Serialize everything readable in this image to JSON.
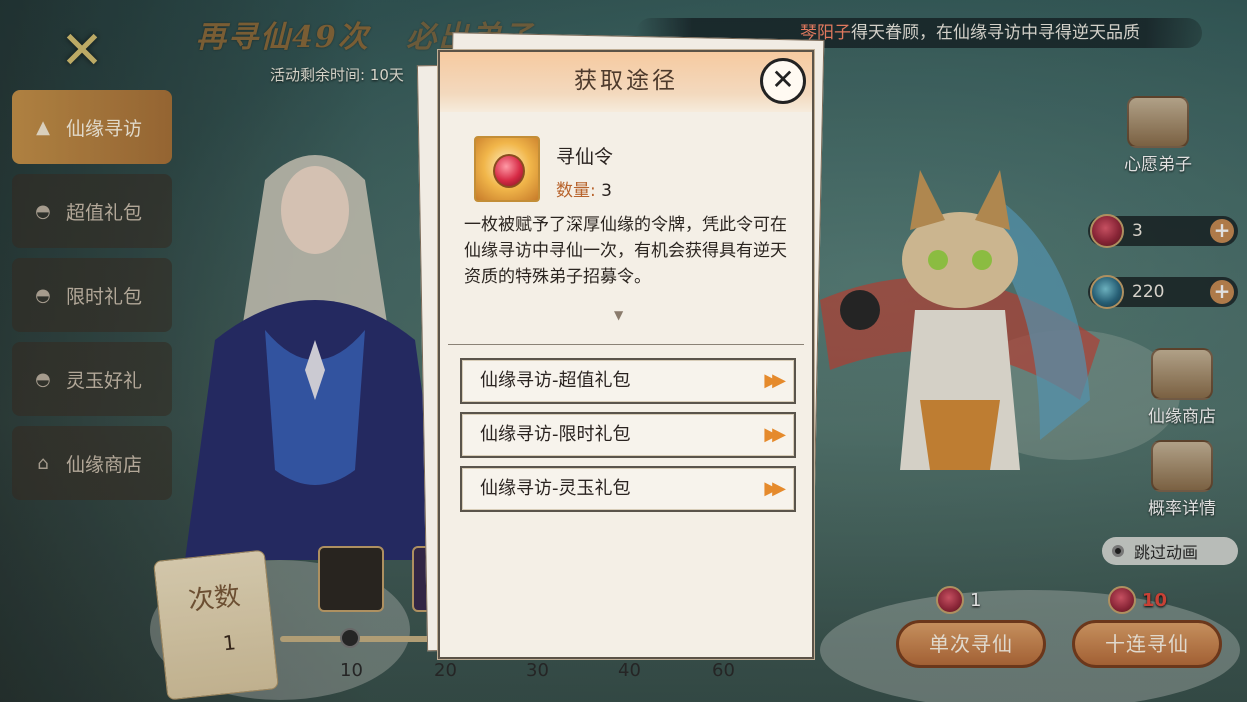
{
  "banner": {
    "title": "再寻仙49次",
    "title_tail": "必出弟子",
    "timer": "活动剩余时间: 10天"
  },
  "marquee": {
    "player": "琴阳子",
    "message": "得天眷顾，在仙缘寻访中寻得逆天品质"
  },
  "nav": {
    "items": [
      {
        "label": "仙缘寻访",
        "icon": "spirit-icon"
      },
      {
        "label": "超值礼包",
        "icon": "pouch-icon"
      },
      {
        "label": "限时礼包",
        "icon": "pouch-icon"
      },
      {
        "label": "灵玉好礼",
        "icon": "pouch-icon"
      },
      {
        "label": "仙缘商店",
        "icon": "shop-icon"
      }
    ]
  },
  "side": {
    "wish": "心愿弟子",
    "shop": "仙缘商店",
    "prob": "概率详情",
    "token_count": "3",
    "jade_count": "220",
    "skip": "跳过动画"
  },
  "draw": {
    "single_cost": "1",
    "ten_cost": "10",
    "single_label": "单次寻仙",
    "ten_label": "十连寻仙"
  },
  "progress": {
    "scroll_label": "次数",
    "count": "1",
    "ticks": [
      "10",
      "20",
      "30",
      "40",
      "60"
    ]
  },
  "modal": {
    "title": "获取途径",
    "close_icon": "close-icon",
    "item_name": "寻仙令",
    "qty_label": "数量:",
    "qty_value": "3",
    "description": "一枚被赋予了深厚仙缘的令牌，凭此令可在仙缘寻访中寻仙一次，有机会获得具有逆天资质的特殊弟子招募令。",
    "routes": [
      {
        "label": "仙缘寻访-超值礼包"
      },
      {
        "label": "仙缘寻访-限时礼包"
      },
      {
        "label": "仙缘寻访-灵玉礼包"
      }
    ],
    "accent": "#e58a2c"
  }
}
